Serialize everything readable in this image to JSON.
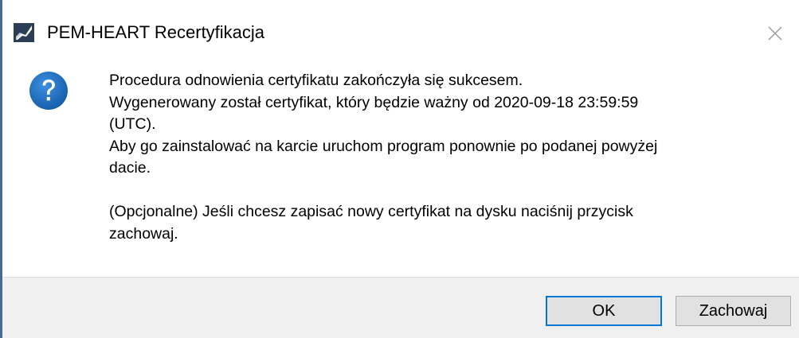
{
  "window": {
    "title": "PEM-HEART Recertyfikacja"
  },
  "icons": {
    "app": "pem-heart-app-icon",
    "close": "close-icon",
    "message": "question-icon"
  },
  "message": {
    "lines": [
      "Procedura odnowienia certyfikatu zakończyła się sukcesem.",
      "Wygenerowany został certyfikat, który będzie ważny od 2020-09-18 23:59:59",
      "(UTC).",
      "Aby go zainstalować na karcie uruchom program ponownie po podanej powyżej",
      "dacie.",
      "(Opcjonalne) Jeśli chcesz zapisać nowy certyfikat na dysku naciśnij przycisk",
      "zachowaj."
    ]
  },
  "buttons": {
    "ok_label": "OK",
    "save_label": "Zachowaj"
  },
  "colors": {
    "accent": "#0078d7",
    "question_icon": "#1a6fc4",
    "frame": "#4a6a92",
    "button_bar": "#f0f0f0"
  }
}
